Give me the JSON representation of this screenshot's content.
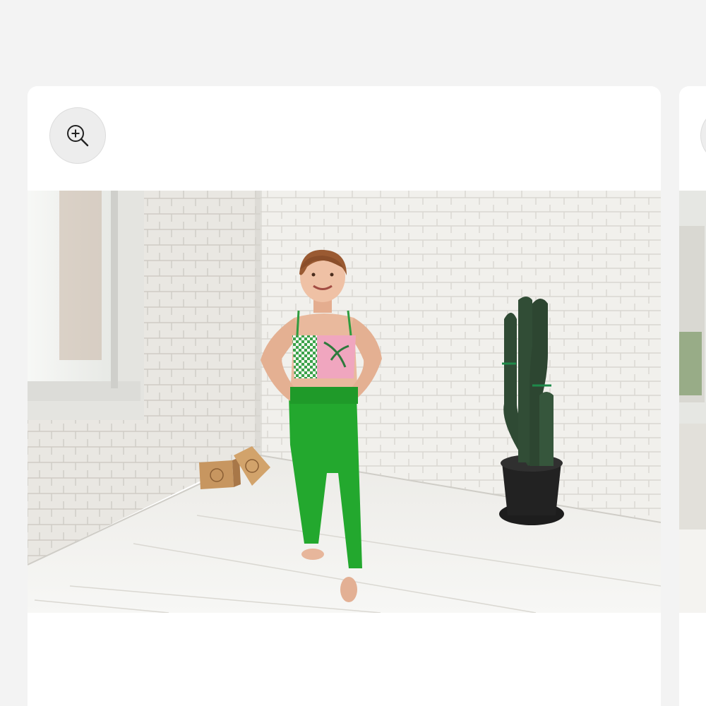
{
  "gallery": {
    "zoom_button": {
      "icon": "zoom-in-icon"
    },
    "active_image": {
      "subject": "product-photo"
    }
  },
  "colors": {
    "page_background": "#f3f3f3",
    "card_background": "#ffffff",
    "zoom_button_background": "#ededed",
    "leggings_green": "#23a82e"
  }
}
